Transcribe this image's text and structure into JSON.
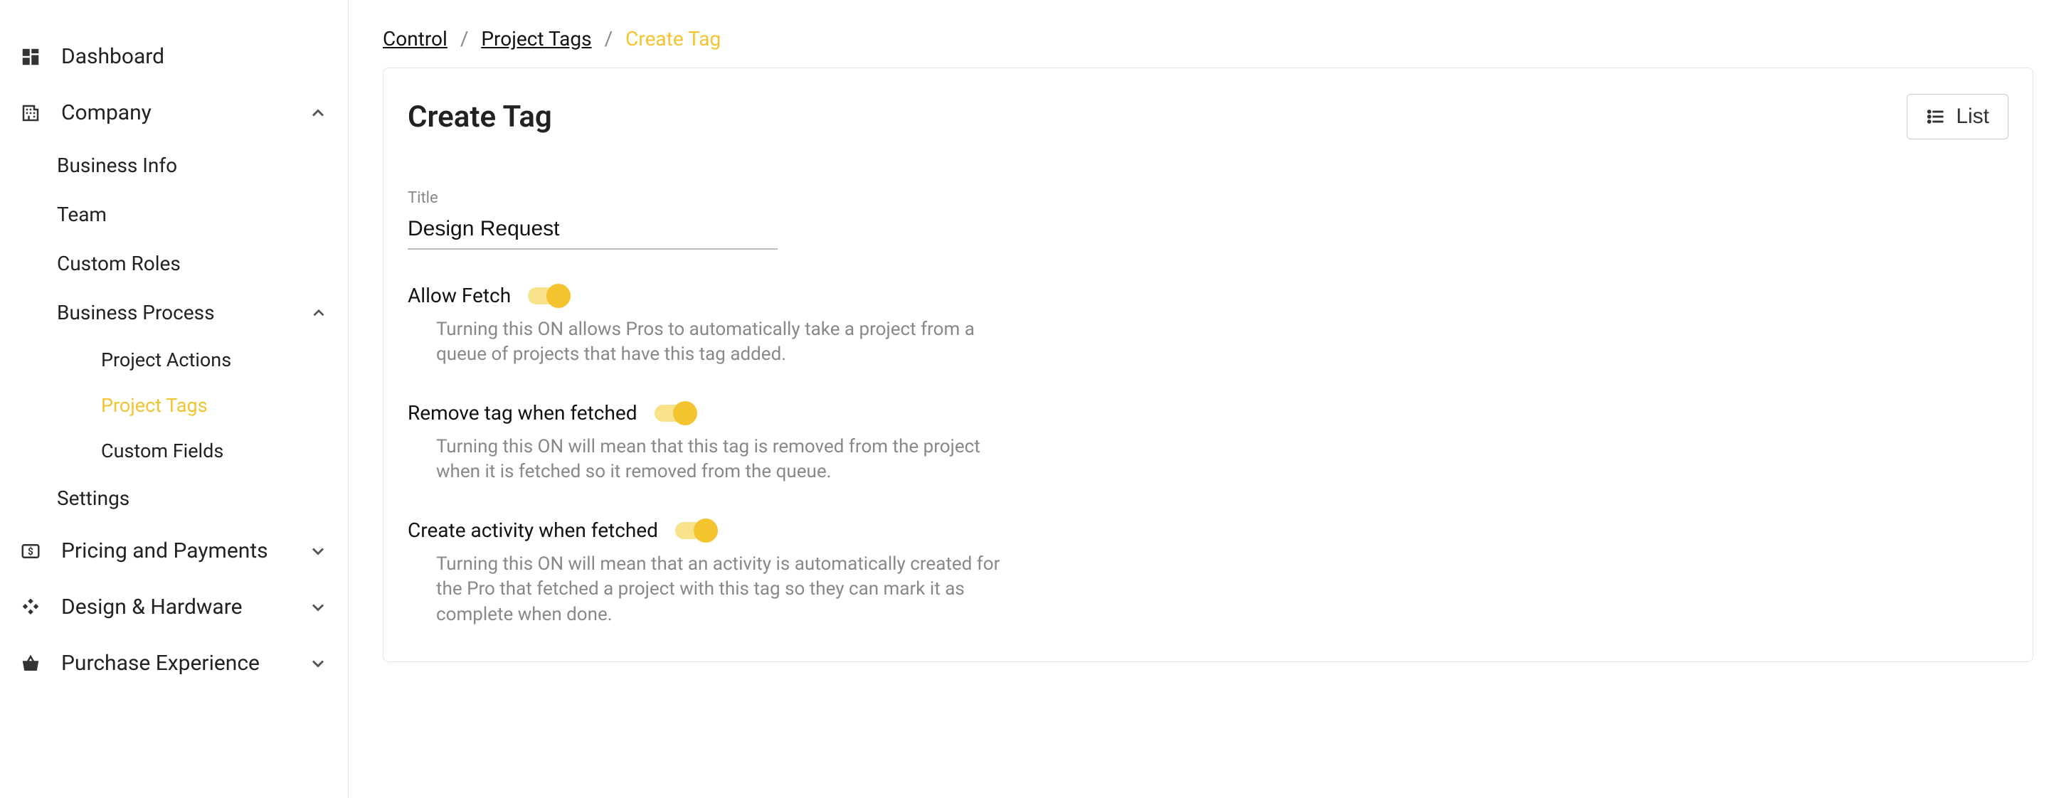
{
  "sidebar": {
    "dashboard": "Dashboard",
    "company": {
      "label": "Company",
      "business_info": "Business Info",
      "team": "Team",
      "custom_roles": "Custom Roles",
      "business_process": {
        "label": "Business Process",
        "project_actions": "Project Actions",
        "project_tags": "Project Tags",
        "custom_fields": "Custom Fields"
      },
      "settings": "Settings"
    },
    "pricing": "Pricing and Payments",
    "design": "Design & Hardware",
    "purchase": "Purchase Experience"
  },
  "breadcrumb": {
    "control": "Control",
    "project_tags": "Project Tags",
    "create_tag": "Create Tag"
  },
  "page": {
    "title": "Create Tag",
    "list_button": "List",
    "title_field_label": "Title",
    "title_field_value": "Design Request",
    "allow_fetch": {
      "label": "Allow Fetch",
      "help": "Turning this ON allows Pros to automatically take a project from a queue of projects that have this tag added."
    },
    "remove_tag": {
      "label": "Remove tag when fetched",
      "help": "Turning this ON will mean that this tag is removed from the project when it is fetched so it removed from the queue."
    },
    "create_activity": {
      "label": "Create activity when fetched",
      "help": "Turning this ON will mean that an activity is automatically created for the Pro that fetched a project with this tag so they can mark it as complete when done."
    }
  }
}
